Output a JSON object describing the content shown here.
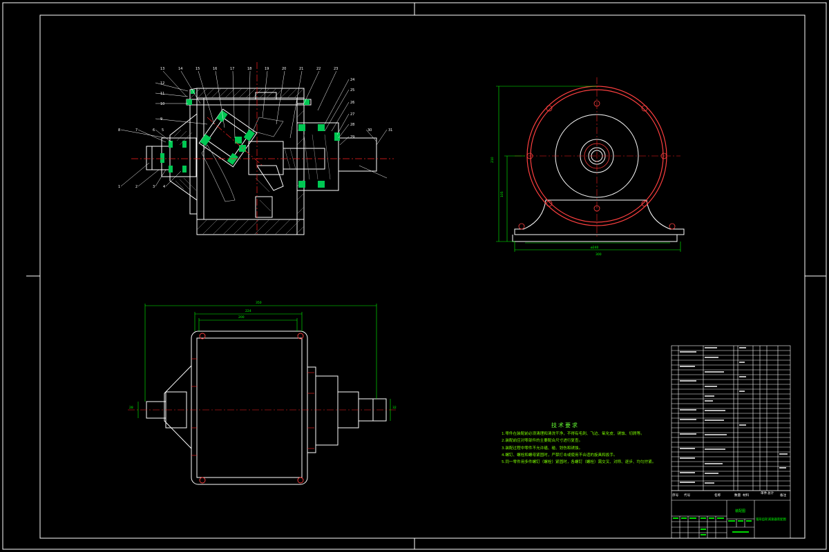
{
  "drawing": {
    "background": "#000000",
    "colors": {
      "outline": "#ffffff",
      "dimension": "#00ff00",
      "centerline": "#ff2020",
      "hatch": "#bfbfbf",
      "section_fill": "#00c853"
    },
    "technical_requirements": {
      "title": "技术要求",
      "items": [
        "1.零件在装配前必须清理和清洗干净，不得有毛刺、飞边、氧化皮、锈蚀、切屑等。",
        "2.装配前应对零部件的主要配合尺寸进行复查。",
        "3.装配过程中零件不允许磕、碰、划伤和锈蚀。",
        "4.螺钉、螺栓和螺母紧固时，严禁打击或使用不合适的旋具和扳手。",
        "5.同一零件用多件螺钉（螺栓）紧固时，各螺钉（螺栓）需交叉、对称、逐步、均匀拧紧。"
      ]
    },
    "parts_list_header": [
      "序号",
      "代号",
      "名称",
      "数量",
      "材料",
      "单件",
      "总计",
      "备注"
    ],
    "title_block": {
      "drawing_name": "锥形齿轮减速器装配图",
      "assembly_label": "装配图"
    },
    "balloon_labels_top": [
      "13",
      "14",
      "15",
      "16",
      "17",
      "18",
      "19",
      "20",
      "21",
      "22",
      "23"
    ],
    "balloon_labels_left": [
      "12",
      "11",
      "10",
      "9",
      "8",
      "7",
      "6",
      "5"
    ],
    "balloon_labels_bottom": [
      "1",
      "2",
      "3",
      "4"
    ],
    "balloon_labels_right": [
      "24",
      "25",
      "26",
      "27",
      "28",
      "29",
      "30",
      "31"
    ]
  }
}
